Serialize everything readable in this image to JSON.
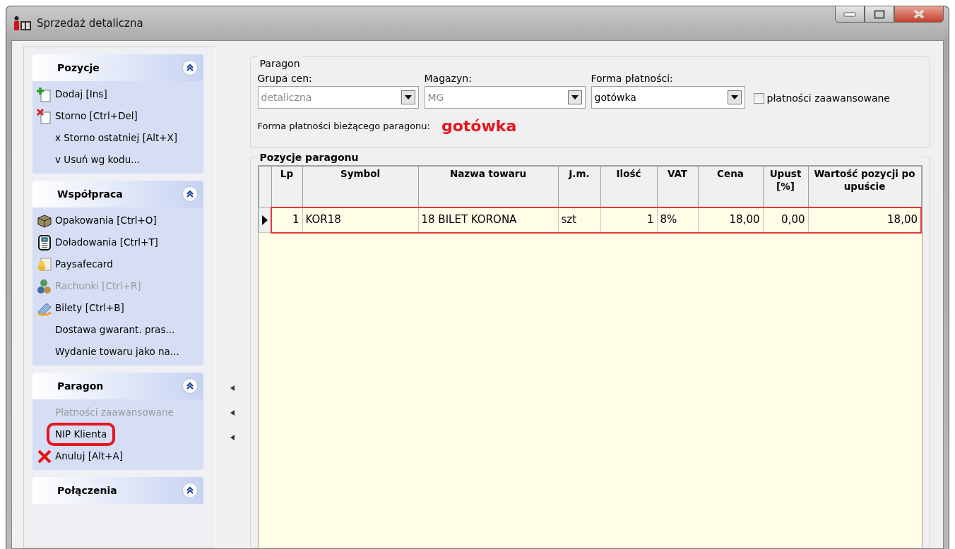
{
  "window": {
    "title": "Sprzedaż detaliczna"
  },
  "task_groups": [
    {
      "title": "Pozycje",
      "expanded": true,
      "items": [
        {
          "label": "Dodaj [Ins]",
          "disabled": false,
          "highlighted": false
        },
        {
          "label": "Storno [Ctrl+Del]",
          "disabled": false,
          "highlighted": false
        },
        {
          "label": "x Storno ostatniej [Alt+X]",
          "disabled": false,
          "highlighted": false
        },
        {
          "label": "v Usuń wg kodu...",
          "disabled": false,
          "highlighted": false
        }
      ]
    },
    {
      "title": "Współpraca",
      "expanded": true,
      "items": [
        {
          "label": "Opakowania [Ctrl+O]",
          "disabled": false,
          "highlighted": false
        },
        {
          "label": "Doładowania [Ctrl+T]",
          "disabled": false,
          "highlighted": false
        },
        {
          "label": "Paysafecard",
          "disabled": false,
          "highlighted": false
        },
        {
          "label": "Rachunki [Ctrl+R]",
          "disabled": true,
          "highlighted": false
        },
        {
          "label": "Bilety [Ctrl+B]",
          "disabled": false,
          "highlighted": false
        },
        {
          "label": "Dostawa gwarant. pras...",
          "disabled": false,
          "highlighted": false
        },
        {
          "label": "Wydanie towaru jako na...",
          "disabled": false,
          "highlighted": false
        }
      ]
    },
    {
      "title": "Paragon",
      "expanded": true,
      "items": [
        {
          "label": "Płatności zaawansowane",
          "disabled": true,
          "highlighted": false
        },
        {
          "label": "NIP Klienta",
          "disabled": false,
          "highlighted": true
        },
        {
          "label": "Anuluj [Alt+A]",
          "disabled": false,
          "highlighted": false
        }
      ]
    },
    {
      "title": "Połączenia",
      "expanded": true
    }
  ],
  "paragon": {
    "title": "Paragon",
    "fields": [
      {
        "label": "Grupa cen:",
        "value": "detaliczna",
        "disabled": true
      },
      {
        "label": "Magazyn:",
        "value": "MG",
        "disabled": true
      },
      {
        "label": "Forma płatności:",
        "value": "gotówka",
        "disabled": false
      }
    ],
    "advanced_checkbox": {
      "label": "płatności zaawansowane",
      "checked": false
    },
    "current_payment_label": "Forma płatności bieżącego paragonu:",
    "current_payment_value": "gotówka"
  },
  "positions": {
    "title": "Pozycje paragonu",
    "columns": [
      "Lp",
      "Symbol",
      "Nazwa towaru",
      "J.m.",
      "Ilość",
      "VAT",
      "Cena",
      "Upust [%]",
      "Wartość pozycji po upuście"
    ],
    "rows": [
      {
        "selected": true,
        "cells": [
          "1",
          "KOR18",
          "18 BILET KORONA",
          "szt",
          "1",
          "8%",
          "18,00",
          "0,00",
          "18,00"
        ]
      }
    ]
  }
}
